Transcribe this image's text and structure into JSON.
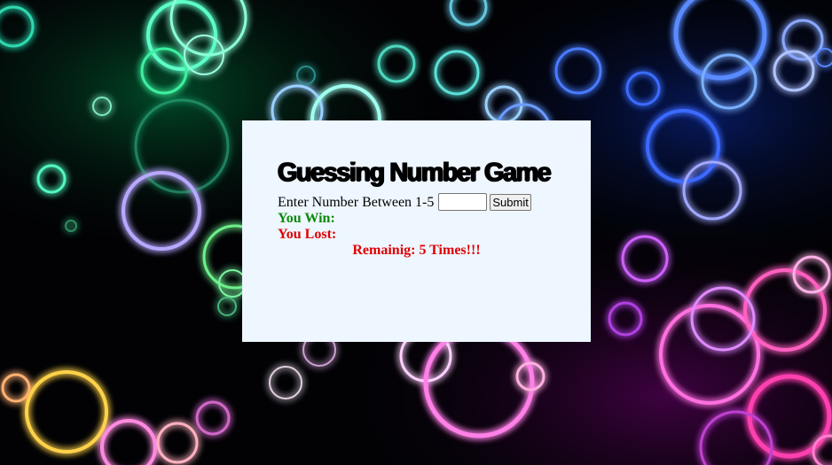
{
  "game": {
    "title": "Guessing Number Game",
    "prompt_label": "Enter Number Between 1-5",
    "input_value": "",
    "submit_label": "Submit",
    "win_label": "You Win:",
    "lost_label": "You Lost:",
    "remaining_text": "Remainig: 5 Times!!!"
  },
  "colors": {
    "panel_background": "#eef6ff",
    "win_text": "#0a8a0a",
    "lost_text": "#e00000",
    "background": "#020205"
  },
  "background_image": "glowing neon bubble rings on black"
}
